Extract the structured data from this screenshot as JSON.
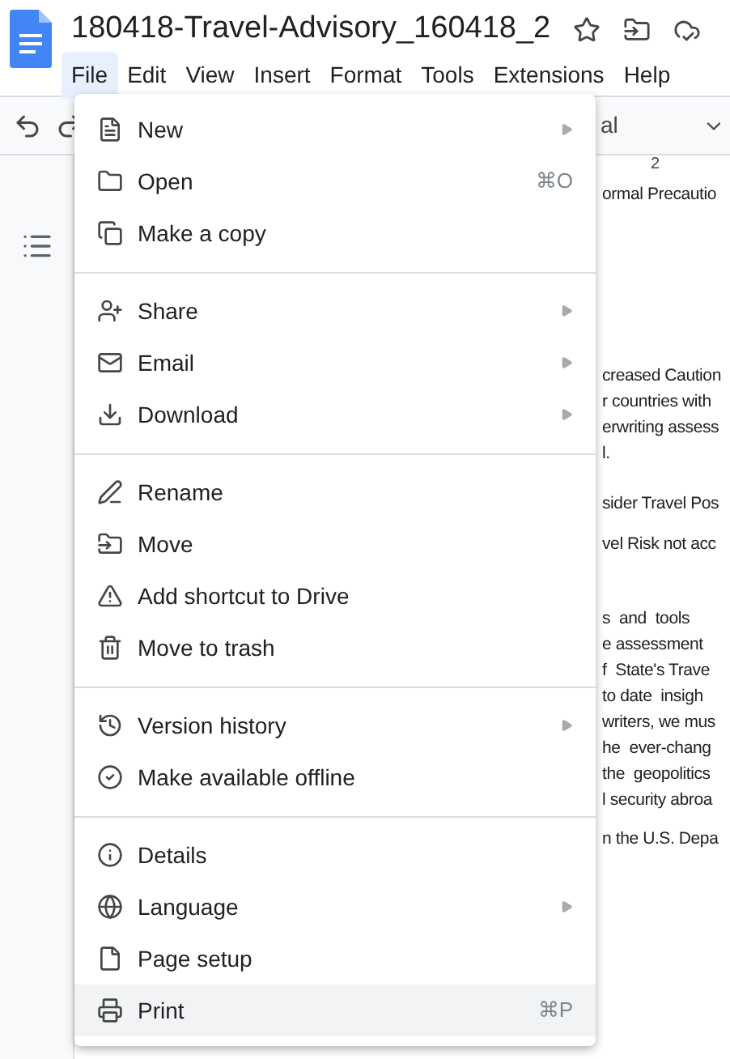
{
  "title": "180418-Travel-Advisory_160418_2",
  "menubar": [
    {
      "label": "File",
      "selected": true
    },
    {
      "label": "Edit",
      "selected": false
    },
    {
      "label": "View",
      "selected": false
    },
    {
      "label": "Insert",
      "selected": false
    },
    {
      "label": "Format",
      "selected": false
    },
    {
      "label": "Tools",
      "selected": false
    },
    {
      "label": "Extensions",
      "selected": false
    },
    {
      "label": "Help",
      "selected": false
    }
  ],
  "toolbar": {
    "style_dropdown": "al"
  },
  "ruler": {
    "mark": "2"
  },
  "document_paragraphs": [
    [
      "ormal Precautio"
    ],
    [
      "creased Caution",
      "r countries with",
      "erwriting assess",
      "l."
    ],
    [
      "sider Travel Pos"
    ],
    [
      "vel Risk not acc"
    ],
    [
      "s  and  tools",
      "e assessment",
      "f  State's Trave",
      "to date  insigh",
      "writers, we mus",
      "he  ever-chang",
      "the  geopolitics",
      "l security abroa"
    ],
    [
      "n the U.S. Depa"
    ]
  ],
  "file_menu": [
    [
      {
        "label": "New",
        "kind": "submenu",
        "selected": false
      },
      {
        "label": "Open",
        "kind": "shortcut",
        "shortcut": "⌘O",
        "selected": false
      },
      {
        "label": "Make a copy",
        "kind": "plain",
        "selected": false
      }
    ],
    [
      {
        "label": "Share",
        "kind": "submenu",
        "selected": false
      },
      {
        "label": "Email",
        "kind": "submenu",
        "selected": false
      },
      {
        "label": "Download",
        "kind": "submenu",
        "selected": false
      }
    ],
    [
      {
        "label": "Rename",
        "kind": "plain",
        "selected": false
      },
      {
        "label": "Move",
        "kind": "plain",
        "selected": false
      },
      {
        "label": "Add shortcut to Drive",
        "kind": "plain",
        "selected": false
      },
      {
        "label": "Move to trash",
        "kind": "plain",
        "selected": false
      }
    ],
    [
      {
        "label": "Version history",
        "kind": "submenu",
        "selected": false
      },
      {
        "label": "Make available offline",
        "kind": "plain",
        "selected": false
      }
    ],
    [
      {
        "label": "Details",
        "kind": "plain",
        "selected": false
      },
      {
        "label": "Language",
        "kind": "submenu",
        "selected": false
      },
      {
        "label": "Page setup",
        "kind": "plain",
        "selected": false
      },
      {
        "label": "Print",
        "kind": "shortcut",
        "shortcut": "⌘P",
        "selected": true
      }
    ]
  ]
}
